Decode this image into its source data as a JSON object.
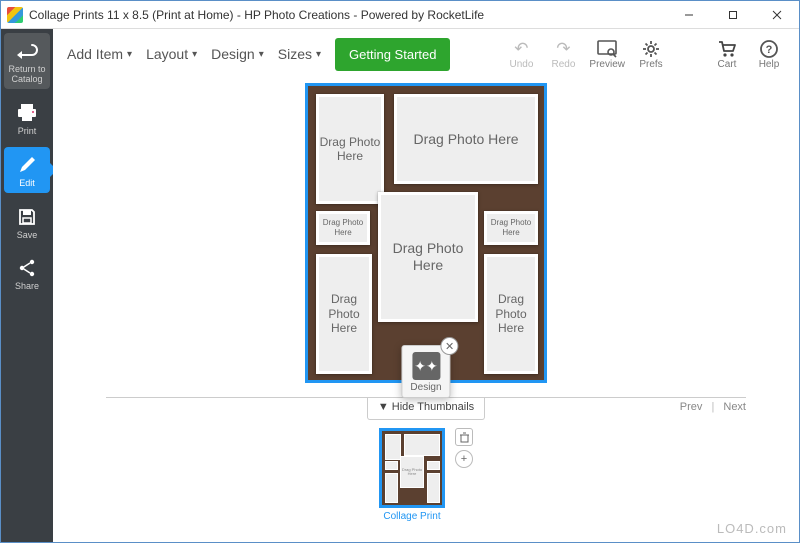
{
  "window": {
    "title": "Collage Prints 11 x 8.5 (Print at Home) - HP Photo Creations - Powered by RocketLife"
  },
  "sidebar": {
    "return": "Return to Catalog",
    "print": "Print",
    "edit": "Edit",
    "save": "Save",
    "share": "Share"
  },
  "toolbar": {
    "add_item": "Add Item",
    "layout": "Layout",
    "design": "Design",
    "sizes": "Sizes",
    "getting_started": "Getting Started",
    "undo": "Undo",
    "redo": "Redo",
    "preview": "Preview",
    "prefs": "Prefs",
    "cart": "Cart",
    "help": "Help"
  },
  "canvas": {
    "drag_photo": "Drag Photo Here",
    "design_popup": "Design"
  },
  "thumbs": {
    "hide": "Hide Thumbnails",
    "prev": "Prev",
    "next": "Next",
    "item_label": "Collage Print"
  },
  "watermark": "LO4D.com"
}
